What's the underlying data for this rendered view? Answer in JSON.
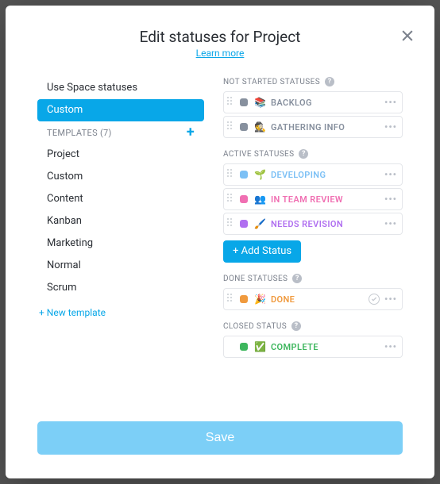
{
  "header": {
    "title": "Edit statuses for Project",
    "learn_more": "Learn more"
  },
  "left": {
    "use_space": "Use Space statuses",
    "custom": "Custom",
    "templates_header": "TEMPLATES (7)",
    "templates": [
      {
        "label": "Project"
      },
      {
        "label": "Custom"
      },
      {
        "label": "Content"
      },
      {
        "label": "Kanban"
      },
      {
        "label": "Marketing"
      },
      {
        "label": "Normal"
      },
      {
        "label": "Scrum"
      }
    ],
    "new_template": "+ New template"
  },
  "groups": {
    "not_started": {
      "label": "NOT STARTED STATUSES",
      "items": [
        {
          "color": "#87909e",
          "emoji": "📚",
          "label": "BACKLOG",
          "text_color": "#87909e"
        },
        {
          "color": "#87909e",
          "emoji": "🕵️",
          "label": "GATHERING INFO",
          "text_color": "#87909e"
        }
      ]
    },
    "active": {
      "label": "ACTIVE STATUSES",
      "items": [
        {
          "color": "#7cc0f5",
          "emoji": "🌱",
          "label": "DEVELOPING",
          "text_color": "#7cc0f5"
        },
        {
          "color": "#f06fb2",
          "emoji": "👥",
          "label": "IN TEAM REVIEW",
          "text_color": "#f06fb2"
        },
        {
          "color": "#b06ff0",
          "emoji": "🖌️",
          "label": "NEEDS REVISION",
          "text_color": "#b06ff0"
        }
      ],
      "add_label": "+ Add Status"
    },
    "done": {
      "label": "DONE STATUSES",
      "items": [
        {
          "color": "#f09a3e",
          "emoji": "🎉",
          "label": "DONE",
          "text_color": "#f09a3e",
          "check": true
        }
      ]
    },
    "closed": {
      "label": "CLOSED STATUS",
      "items": [
        {
          "color": "#3db65d",
          "emoji": "✅",
          "label": "COMPLETE",
          "text_color": "#3db65d",
          "no_drag": true
        }
      ]
    }
  },
  "footer": {
    "save": "Save"
  }
}
